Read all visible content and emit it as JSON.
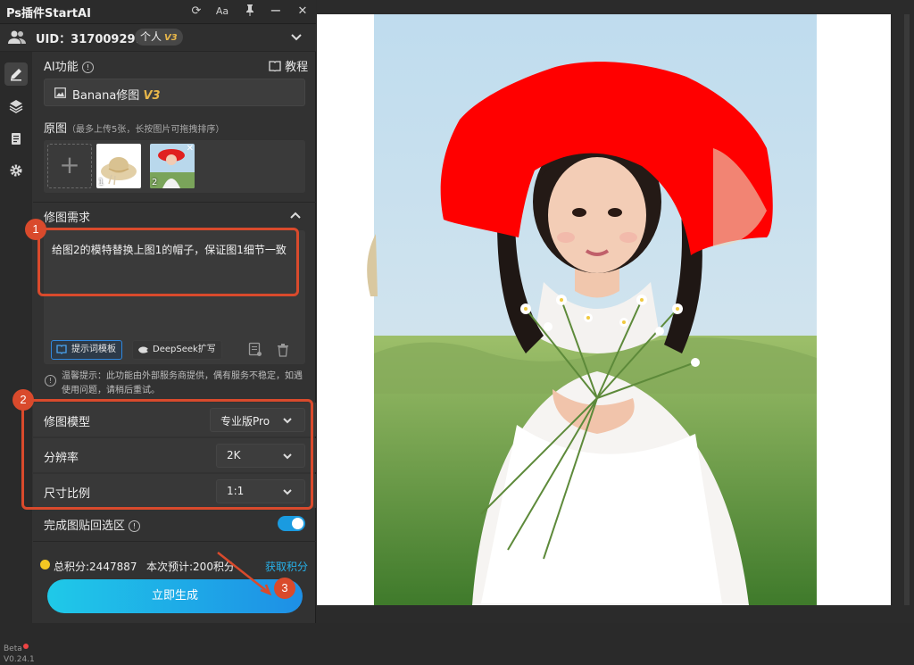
{
  "app": {
    "title": "Ps插件StartAI"
  },
  "user": {
    "uid_text": "UID：317009291",
    "plan_label": "个人",
    "plan_version": "V3"
  },
  "ai_function": {
    "label": "AI功能",
    "tutorial_label": "教程",
    "selected_tool": "Banana修图",
    "tool_version": "V3"
  },
  "source_images": {
    "label": "原图",
    "hint": "（最多上传5张，长按图片可拖拽排序）",
    "thumbs": [
      {
        "index": "1"
      },
      {
        "index": "2"
      }
    ]
  },
  "request": {
    "label": "修图需求",
    "text": "给图2的模特替换上图1的帽子，保证图1细节一致",
    "template_label": "提示词模板",
    "deepseek_label": "DeepSeek扩写"
  },
  "warning": {
    "text": "温馨提示：此功能由外部服务商提供，偶有服务不稳定，如遇使用问题，请稍后重试。"
  },
  "settings": [
    {
      "label": "修图模型",
      "value": "专业版Pro"
    },
    {
      "label": "分辨率",
      "value": "2K"
    },
    {
      "label": "尺寸比例",
      "value": "1:1"
    }
  ],
  "paste_back": {
    "label": "完成图贴回选区",
    "enabled": true
  },
  "footer": {
    "total_points": "总积分:2447887",
    "estimate": "本次预计:200积分",
    "get_points": "获取积分",
    "generate_label": "立即生成"
  },
  "version": {
    "beta": "Beta",
    "number": "V0.24.1"
  },
  "annotations": [
    "1",
    "2",
    "3"
  ],
  "colors": {
    "accent": "#1e8fe6",
    "annotation": "#d94a2c",
    "hat_overlay": "#ff0000",
    "toggle_on": "#1a9be0"
  }
}
